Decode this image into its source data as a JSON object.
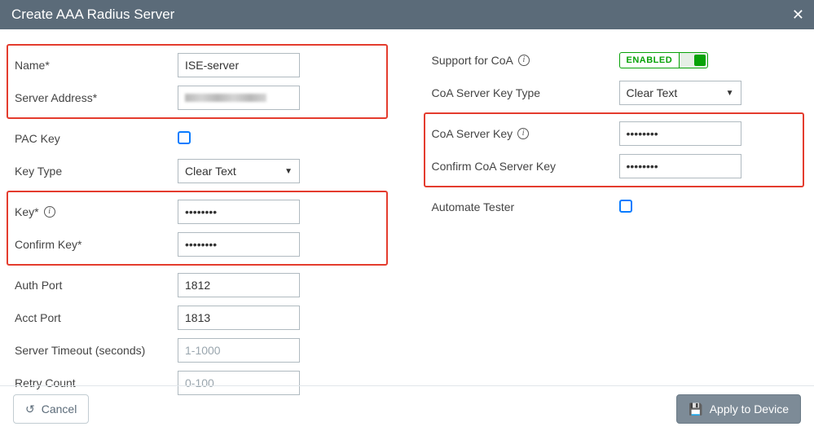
{
  "title": "Create AAA Radius Server",
  "left": {
    "name_label": "Name*",
    "name_value": "ISE-server",
    "server_address_label": "Server Address*",
    "server_address_value": "",
    "pac_key_label": "PAC Key",
    "key_type_label": "Key Type",
    "key_type_value": "Clear Text",
    "key_label": "Key*",
    "key_value": "••••••••",
    "confirm_key_label": "Confirm Key*",
    "confirm_key_value": "••••••••",
    "auth_port_label": "Auth Port",
    "auth_port_value": "1812",
    "acct_port_label": "Acct Port",
    "acct_port_value": "1813",
    "server_timeout_label": "Server Timeout (seconds)",
    "server_timeout_placeholder": "1-1000",
    "retry_count_label": "Retry Count",
    "retry_count_placeholder": "0-100"
  },
  "right": {
    "support_coa_label": "Support for CoA",
    "support_coa_status": "ENABLED",
    "coa_key_type_label": "CoA Server Key Type",
    "coa_key_type_value": "Clear Text",
    "coa_server_key_label": "CoA Server Key",
    "coa_server_key_value": "••••••••",
    "confirm_coa_key_label": "Confirm CoA Server Key",
    "confirm_coa_key_value": "••••••••",
    "automate_tester_label": "Automate Tester"
  },
  "footer": {
    "cancel": "Cancel",
    "apply": "Apply to Device"
  }
}
